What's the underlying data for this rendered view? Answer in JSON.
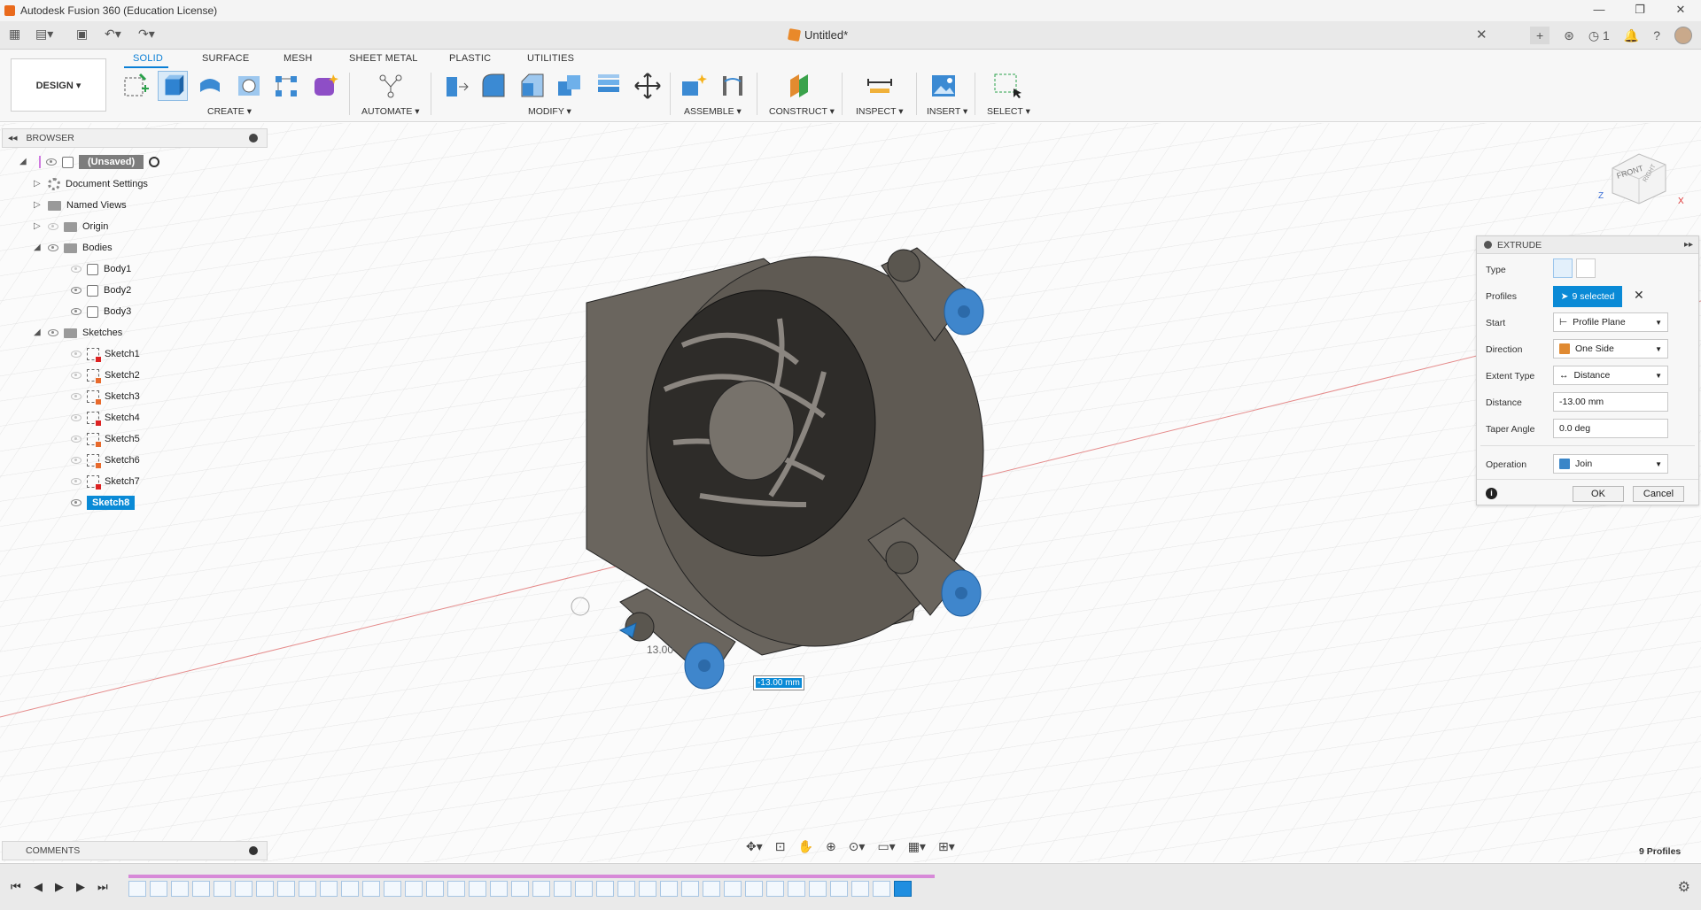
{
  "window": {
    "title": "Autodesk Fusion 360 (Education License)",
    "controls": [
      "—",
      "❐",
      "✕"
    ]
  },
  "document_tab": {
    "label": "Untitled*",
    "close": "✕"
  },
  "header_tools": {
    "jobs_count": "1"
  },
  "toolbar": {
    "design_label": "DESIGN ▾",
    "tabs": [
      "SOLID",
      "SURFACE",
      "MESH",
      "SHEET METAL",
      "PLASTIC",
      "UTILITIES"
    ],
    "groups": [
      "CREATE ▾",
      "AUTOMATE ▾",
      "MODIFY ▾",
      "ASSEMBLE ▾",
      "CONSTRUCT ▾",
      "INSPECT ▾",
      "INSERT ▾",
      "SELECT ▾"
    ]
  },
  "browser": {
    "title": "BROWSER",
    "root": "(Unsaved)",
    "items": [
      {
        "label": "Document Settings"
      },
      {
        "label": "Named Views"
      },
      {
        "label": "Origin"
      },
      {
        "label": "Bodies"
      },
      {
        "label": "Body1"
      },
      {
        "label": "Body2"
      },
      {
        "label": "Body3"
      },
      {
        "label": "Sketches"
      },
      {
        "label": "Sketch1"
      },
      {
        "label": "Sketch2"
      },
      {
        "label": "Sketch3"
      },
      {
        "label": "Sketch4"
      },
      {
        "label": "Sketch5"
      },
      {
        "label": "Sketch6"
      },
      {
        "label": "Sketch7"
      },
      {
        "label": "Sketch8"
      }
    ]
  },
  "extrude": {
    "title": "EXTRUDE",
    "labels": {
      "type": "Type",
      "profiles": "Profiles",
      "start": "Start",
      "direction": "Direction",
      "extent_type": "Extent Type",
      "distance": "Distance",
      "taper_angle": "Taper Angle",
      "operation": "Operation"
    },
    "values": {
      "profiles": "9 selected",
      "start": "Profile Plane",
      "direction": "One Side",
      "extent_type": "Distance",
      "distance": "-13.00 mm",
      "taper_angle": "0.0 deg",
      "operation": "Join"
    },
    "ok": "OK",
    "cancel": "Cancel"
  },
  "viewport": {
    "distance_input": "-13.00 mm",
    "dimension_ghost": "13.00",
    "viewcube": {
      "front": "FRONT",
      "right": "RIGHT",
      "axis_x": "X",
      "axis_z": "Z"
    }
  },
  "comments": {
    "label": "COMMENTS"
  },
  "status": {
    "profiles": "9 Profiles"
  },
  "colors": {
    "accent": "#0a8ad6",
    "body": "#6f6a63",
    "selection": "#3a8fd6"
  }
}
